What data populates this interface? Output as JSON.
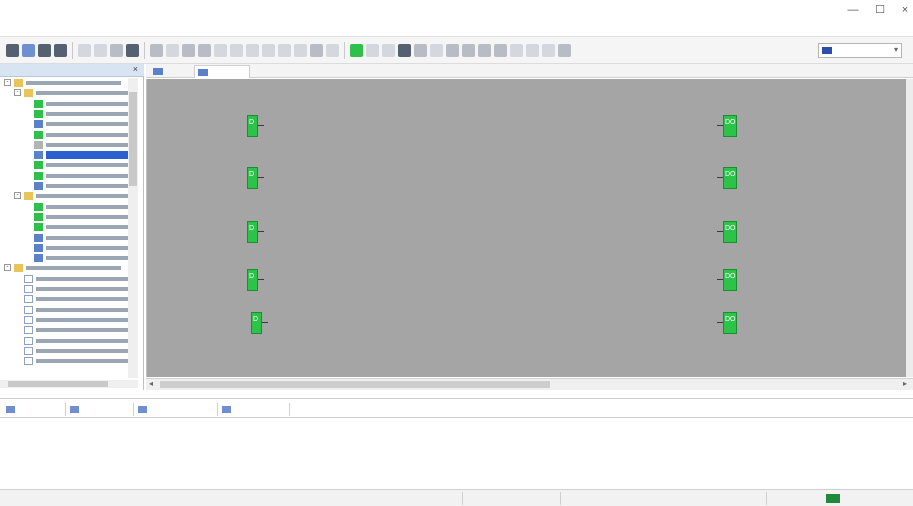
{
  "window": {
    "title": "",
    "minimize_glyph": "—",
    "maximize_glyph": "☐",
    "close_glyph": "×"
  },
  "menu": {
    "items": [
      "",
      "",
      "",
      ""
    ]
  },
  "toolbar": {
    "language_value": "",
    "language_caret": "▾"
  },
  "project_panel": {
    "title": "",
    "close_glyph": "×",
    "tree": [
      {
        "level": 0,
        "expander": "-",
        "icon": "folder",
        "selected": false
      },
      {
        "level": 1,
        "expander": "-",
        "icon": "folder",
        "selected": false
      },
      {
        "level": 2,
        "expander": "",
        "icon": "green",
        "selected": false
      },
      {
        "level": 2,
        "expander": "",
        "icon": "green",
        "selected": false
      },
      {
        "level": 2,
        "expander": "",
        "icon": "blue",
        "selected": false
      },
      {
        "level": 2,
        "expander": "",
        "icon": "green",
        "selected": false
      },
      {
        "level": 2,
        "expander": "",
        "icon": "gray",
        "selected": false
      },
      {
        "level": 2,
        "expander": "",
        "icon": "blue",
        "selected": true
      },
      {
        "level": 2,
        "expander": "",
        "icon": "green",
        "selected": false
      },
      {
        "level": 2,
        "expander": "",
        "icon": "green",
        "selected": false
      },
      {
        "level": 2,
        "expander": "",
        "icon": "blue",
        "selected": false
      },
      {
        "level": 1,
        "expander": "-",
        "icon": "folder",
        "selected": false
      },
      {
        "level": 2,
        "expander": "",
        "icon": "green",
        "selected": false
      },
      {
        "level": 2,
        "expander": "",
        "icon": "green",
        "selected": false
      },
      {
        "level": 2,
        "expander": "",
        "icon": "green",
        "selected": false
      },
      {
        "level": 2,
        "expander": "",
        "icon": "blue",
        "selected": false
      },
      {
        "level": 2,
        "expander": "",
        "icon": "blue",
        "selected": false
      },
      {
        "level": 2,
        "expander": "",
        "icon": "blue",
        "selected": false
      },
      {
        "level": 0,
        "expander": "-",
        "icon": "folder",
        "selected": false
      },
      {
        "level": 1,
        "expander": "",
        "icon": "page",
        "selected": false
      },
      {
        "level": 1,
        "expander": "",
        "icon": "page",
        "selected": false
      },
      {
        "level": 1,
        "expander": "",
        "icon": "page",
        "selected": false
      },
      {
        "level": 1,
        "expander": "",
        "icon": "page",
        "selected": false
      },
      {
        "level": 1,
        "expander": "",
        "icon": "page",
        "selected": false
      },
      {
        "level": 1,
        "expander": "",
        "icon": "page",
        "selected": false
      },
      {
        "level": 1,
        "expander": "",
        "icon": "page",
        "selected": false
      },
      {
        "level": 1,
        "expander": "",
        "icon": "page",
        "selected": false
      },
      {
        "level": 1,
        "expander": "",
        "icon": "page",
        "selected": false
      }
    ]
  },
  "tabs": [
    {
      "label": "",
      "active": false
    },
    {
      "label": "",
      "active": true
    }
  ],
  "canvas": {
    "input_blocks": [
      {
        "label": "",
        "glyph": "D"
      },
      {
        "label": "",
        "glyph": "D"
      },
      {
        "label": "",
        "glyph": "D"
      },
      {
        "label": "",
        "glyph": "D"
      },
      {
        "label": "",
        "glyph": "D"
      }
    ],
    "output_blocks": [
      {
        "label": "",
        "glyph": "DO"
      },
      {
        "label": "",
        "glyph": "DO"
      },
      {
        "label": "",
        "glyph": "DO"
      },
      {
        "label": "",
        "glyph": "DO"
      },
      {
        "label": "",
        "glyph": "DO"
      }
    ]
  },
  "bottom_tabs": [
    "",
    "",
    "",
    ""
  ],
  "statusbar": {
    "left": "",
    "mode": "",
    "device": "",
    "zoom": "",
    "time": ""
  },
  "colors": {
    "canvas_bg": "#a5a5a5",
    "block_green": "#2bc449",
    "selection_blue": "#2c5fcf",
    "connected_green": "#1f8a3a"
  }
}
